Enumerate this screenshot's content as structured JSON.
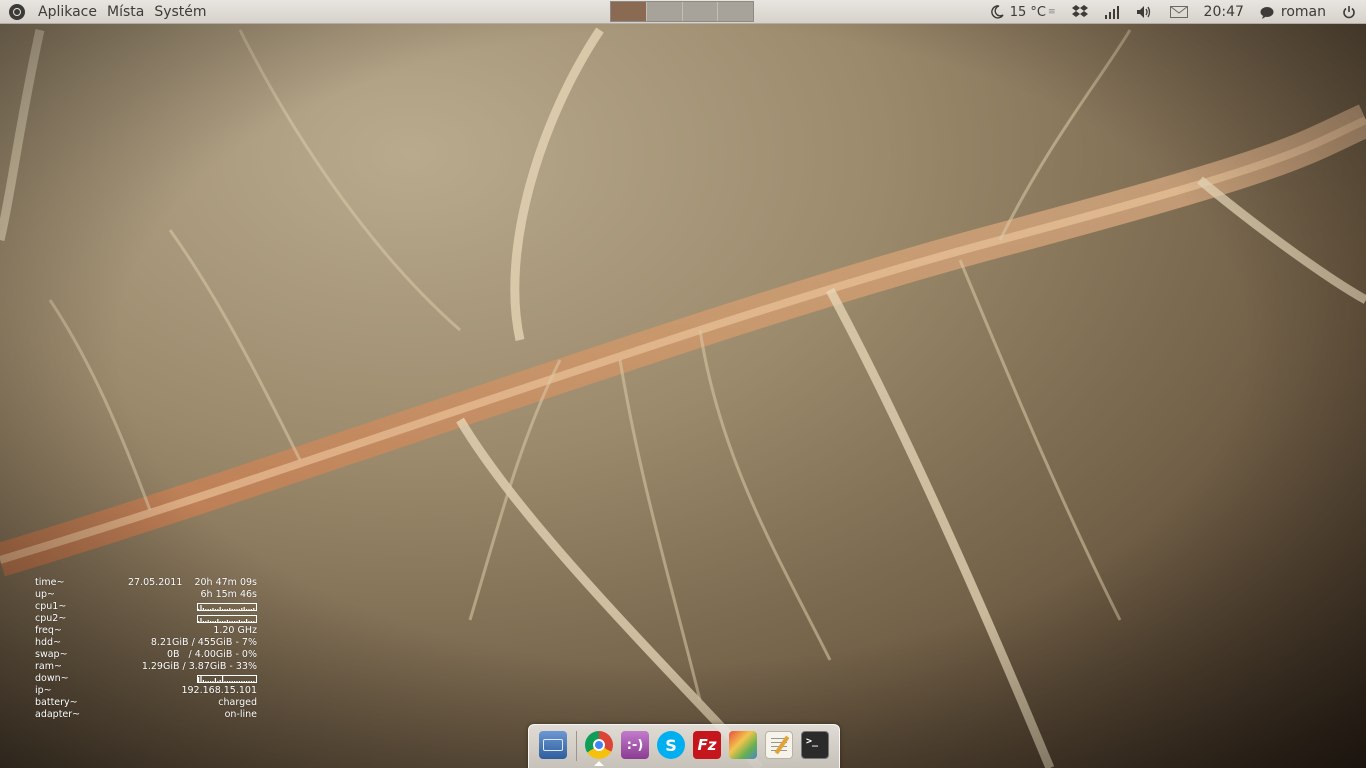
{
  "top_panel": {
    "menus": [
      "Aplikace",
      "Místa",
      "Systém"
    ],
    "workspaces": {
      "count": 4,
      "active_index": 0
    },
    "weather": {
      "temperature": "15 °C",
      "icon": "moon-icon"
    },
    "tray_icons": [
      "dropbox-icon",
      "signal-icon",
      "volume-icon",
      "mail-icon"
    ],
    "clock": "20:47",
    "user": {
      "name": "roman",
      "icon": "chat-bubble-icon"
    },
    "power_icon": "power-icon",
    "colors": {
      "panel_bg": "#dfdbd5",
      "text": "#3c3b37",
      "active_workspace": "#8a6a52"
    }
  },
  "conky": {
    "rows": [
      {
        "label": "time~",
        "value": "27.05.2011    20h 47m 09s",
        "type": "text"
      },
      {
        "label": "up~",
        "value": "6h 15m 46s",
        "type": "text"
      },
      {
        "label": "cpu1~",
        "type": "graph"
      },
      {
        "label": "cpu2~",
        "type": "graph"
      },
      {
        "label": "freq~",
        "value": "1.20 GHz",
        "type": "text"
      },
      {
        "label": "hdd~",
        "value": "8.21GiB / 455GiB - 7%",
        "type": "text"
      },
      {
        "label": "swap~",
        "value": "0B   / 4.00GiB - 0%",
        "type": "text"
      },
      {
        "label": "ram~",
        "value": "1.29GiB / 3.87GiB - 33%",
        "type": "text"
      },
      {
        "label": "down~",
        "type": "graph"
      },
      {
        "label": "ip~",
        "value": "192.168.15.101",
        "type": "text"
      },
      {
        "label": "battery~",
        "value": "charged",
        "type": "text"
      },
      {
        "label": "adapter~",
        "value": "on-line",
        "type": "text"
      }
    ]
  },
  "dock": {
    "items": [
      {
        "name": "show-desktop-icon",
        "color": "#4a79b8",
        "running": false
      },
      {
        "name": "chrome-icon",
        "color": "#dd4b39",
        "running": true
      },
      {
        "name": "empathy-chat-icon",
        "color": "#a05ca8",
        "running": false
      },
      {
        "name": "skype-icon",
        "color": "#00aff0",
        "running": false
      },
      {
        "name": "filezilla-icon",
        "color": "#c4161c",
        "running": false
      },
      {
        "name": "photo-editor-icon",
        "color": "#d4a64a",
        "running": false
      },
      {
        "name": "text-editor-icon",
        "color": "#f2f2ea",
        "running": false
      },
      {
        "name": "terminal-icon",
        "color": "#2b2b2b",
        "running": false
      }
    ]
  }
}
